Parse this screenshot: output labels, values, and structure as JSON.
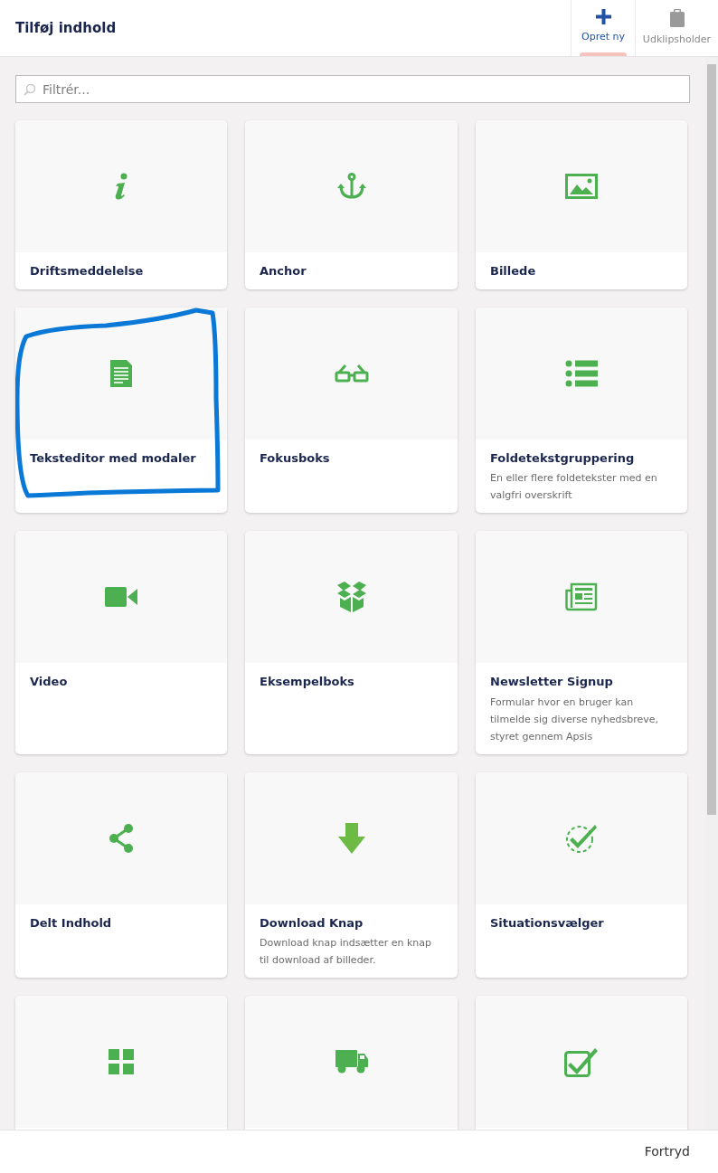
{
  "dialog": {
    "title": "Tilføj indhold"
  },
  "tabs": [
    {
      "label": "Opret ny",
      "selected": true
    },
    {
      "label": "Udklipsholder",
      "selected": false
    }
  ],
  "search": {
    "placeholder": "Filtrér..."
  },
  "items": [
    {
      "title": "Driftsmeddelelse",
      "highlighted": false
    },
    {
      "title": "Anchor",
      "highlighted": false
    },
    {
      "title": "Billede",
      "highlighted": false
    },
    {
      "title": "Teksteditor med modaler",
      "highlighted": true
    },
    {
      "title": "Fokusboks",
      "highlighted": false
    },
    {
      "title": "Foldetekstgruppering",
      "description": "En eller flere foldetekster med en valgfri overskrift",
      "highlighted": false
    },
    {
      "title": "Video",
      "highlighted": false
    },
    {
      "title": "Eksempelboks",
      "highlighted": false
    },
    {
      "title": "Newsletter Signup",
      "description": "Formular hvor en bruger kan tilmelde sig diverse nyhedsbreve, styret gennem Apsis",
      "highlighted": false
    },
    {
      "title": "Delt Indhold",
      "highlighted": false
    },
    {
      "title": "Download Knap",
      "description": "Download knap indsætter en knap til download af billeder.",
      "highlighted": false
    },
    {
      "title": "Situationsvælger",
      "highlighted": false
    },
    {
      "highlighted": false
    },
    {
      "highlighted": false
    },
    {
      "highlighted": false
    }
  ],
  "footer": {
    "cancel": "Fortryd"
  }
}
